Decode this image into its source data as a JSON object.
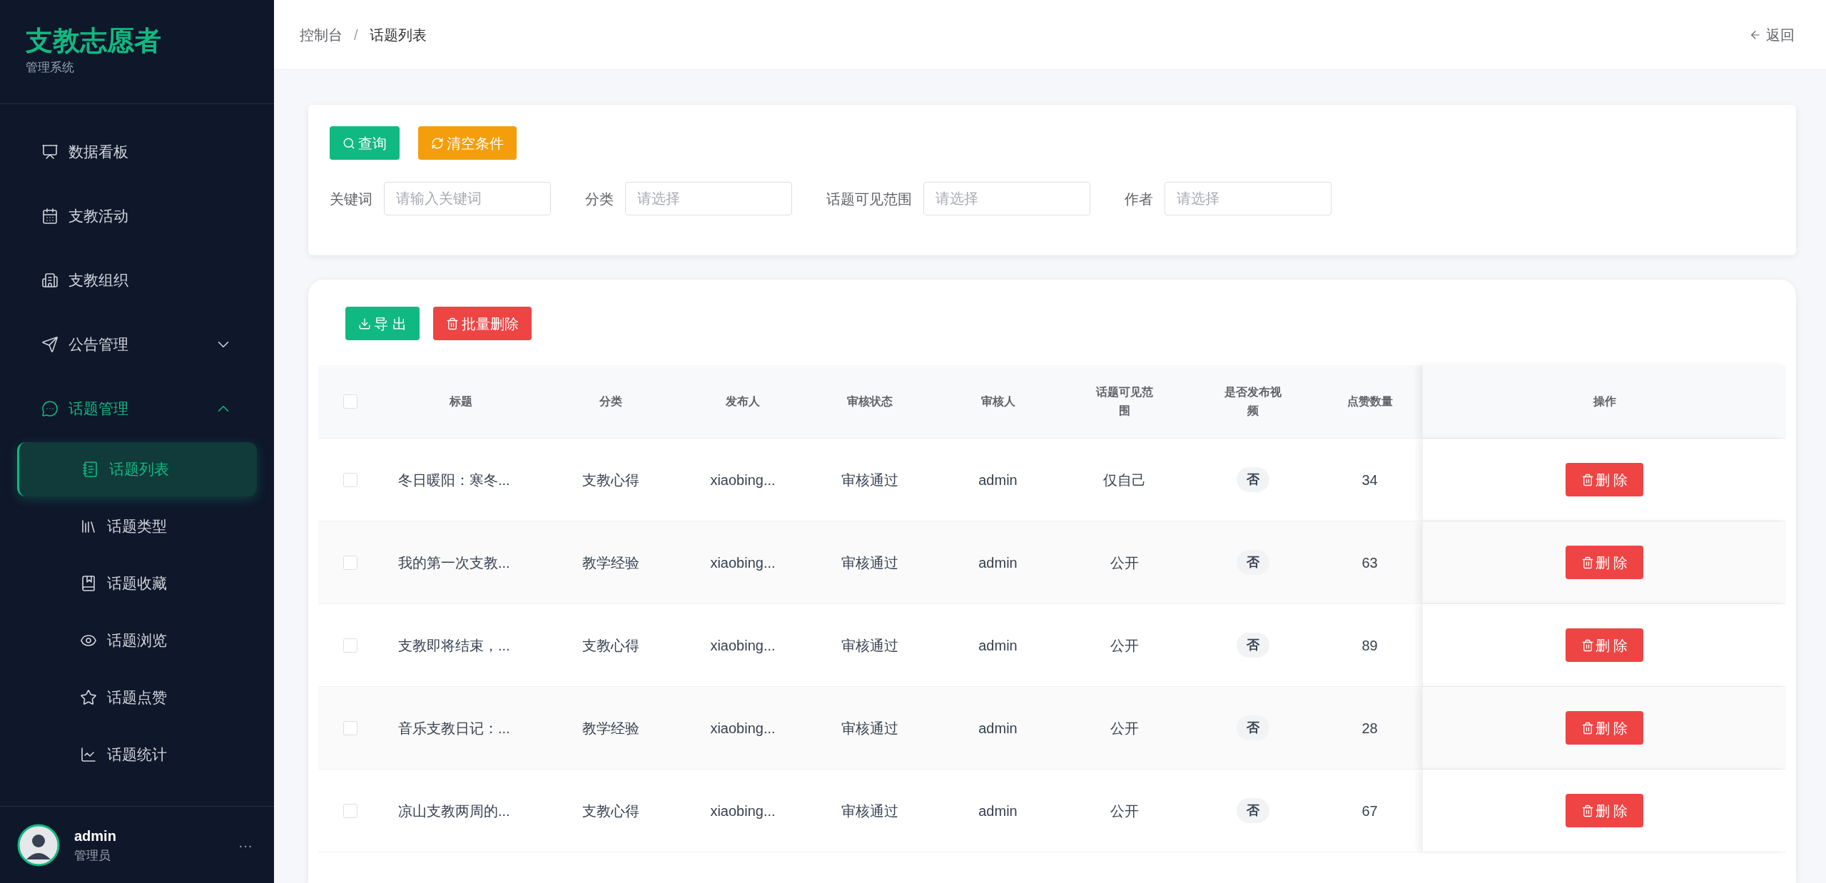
{
  "sidebar": {
    "brand": {
      "title": "支教志愿者",
      "subtitle": "管理系统"
    },
    "menu": [
      {
        "label": "数据看板",
        "selected": false
      },
      {
        "label": "支教活动",
        "selected": false
      },
      {
        "label": "支教组织",
        "selected": false
      },
      {
        "label": "公告管理",
        "selected": false,
        "expanded": false
      },
      {
        "label": "话题管理",
        "selected": true,
        "expanded": true,
        "children": [
          {
            "label": "话题列表",
            "selected": true
          },
          {
            "label": "话题类型",
            "selected": false
          },
          {
            "label": "话题收藏",
            "selected": false
          },
          {
            "label": "话题浏览",
            "selected": false
          },
          {
            "label": "话题点赞",
            "selected": false
          },
          {
            "label": "话题统计",
            "selected": false
          }
        ]
      }
    ],
    "user": {
      "name": "admin",
      "role": "管理员",
      "more": "···"
    }
  },
  "header": {
    "breadcrumb": [
      {
        "label": "控制台",
        "current": false
      },
      {
        "label": "话题列表",
        "current": true
      }
    ],
    "separator": "/",
    "back": "返回"
  },
  "filters": {
    "buttons": [
      {
        "label": "查询",
        "kind": "primary"
      },
      {
        "label": "清空条件",
        "kind": "warning"
      }
    ],
    "fields": [
      {
        "label": "关键词",
        "placeholder": "请输入关键词"
      },
      {
        "label": "分类",
        "placeholder": "请选择"
      },
      {
        "label": "话题可见范围",
        "placeholder": "请选择"
      },
      {
        "label": "作者",
        "placeholder": "请选择"
      }
    ]
  },
  "toolbar": [
    {
      "label": "导 出",
      "kind": "primary"
    },
    {
      "label": "批量删除",
      "kind": "danger"
    }
  ],
  "table": {
    "all_checked": false,
    "columns": [
      "标题",
      "分类",
      "发布人",
      "审核状态",
      "审核人",
      "话题可见范围",
      "是否发布视频",
      "点赞数量",
      "操作"
    ],
    "rows": [
      {
        "checked": false,
        "cells": [
          "冬日暖阳：寒冬...",
          "支教心得",
          "xiaobing...",
          "审核通过",
          "admin",
          "仅自己"
        ],
        "video": "否",
        "likes": "34",
        "action": "删 除"
      },
      {
        "checked": false,
        "cells": [
          "我的第一次支教...",
          "教学经验",
          "xiaobing...",
          "审核通过",
          "admin",
          "公开"
        ],
        "video": "否",
        "likes": "63",
        "action": "删 除"
      },
      {
        "checked": false,
        "cells": [
          "支教即将结束，...",
          "支教心得",
          "xiaobing...",
          "审核通过",
          "admin",
          "公开"
        ],
        "video": "否",
        "likes": "89",
        "action": "删 除"
      },
      {
        "checked": false,
        "cells": [
          "音乐支教日记：...",
          "教学经验",
          "xiaobing...",
          "审核通过",
          "admin",
          "公开"
        ],
        "video": "否",
        "likes": "28",
        "action": "删 除"
      },
      {
        "checked": false,
        "cells": [
          "凉山支教两周的...",
          "支教心得",
          "xiaobing...",
          "审核通过",
          "admin",
          "公开"
        ],
        "video": "否",
        "likes": "67",
        "action": "删 除"
      }
    ]
  }
}
